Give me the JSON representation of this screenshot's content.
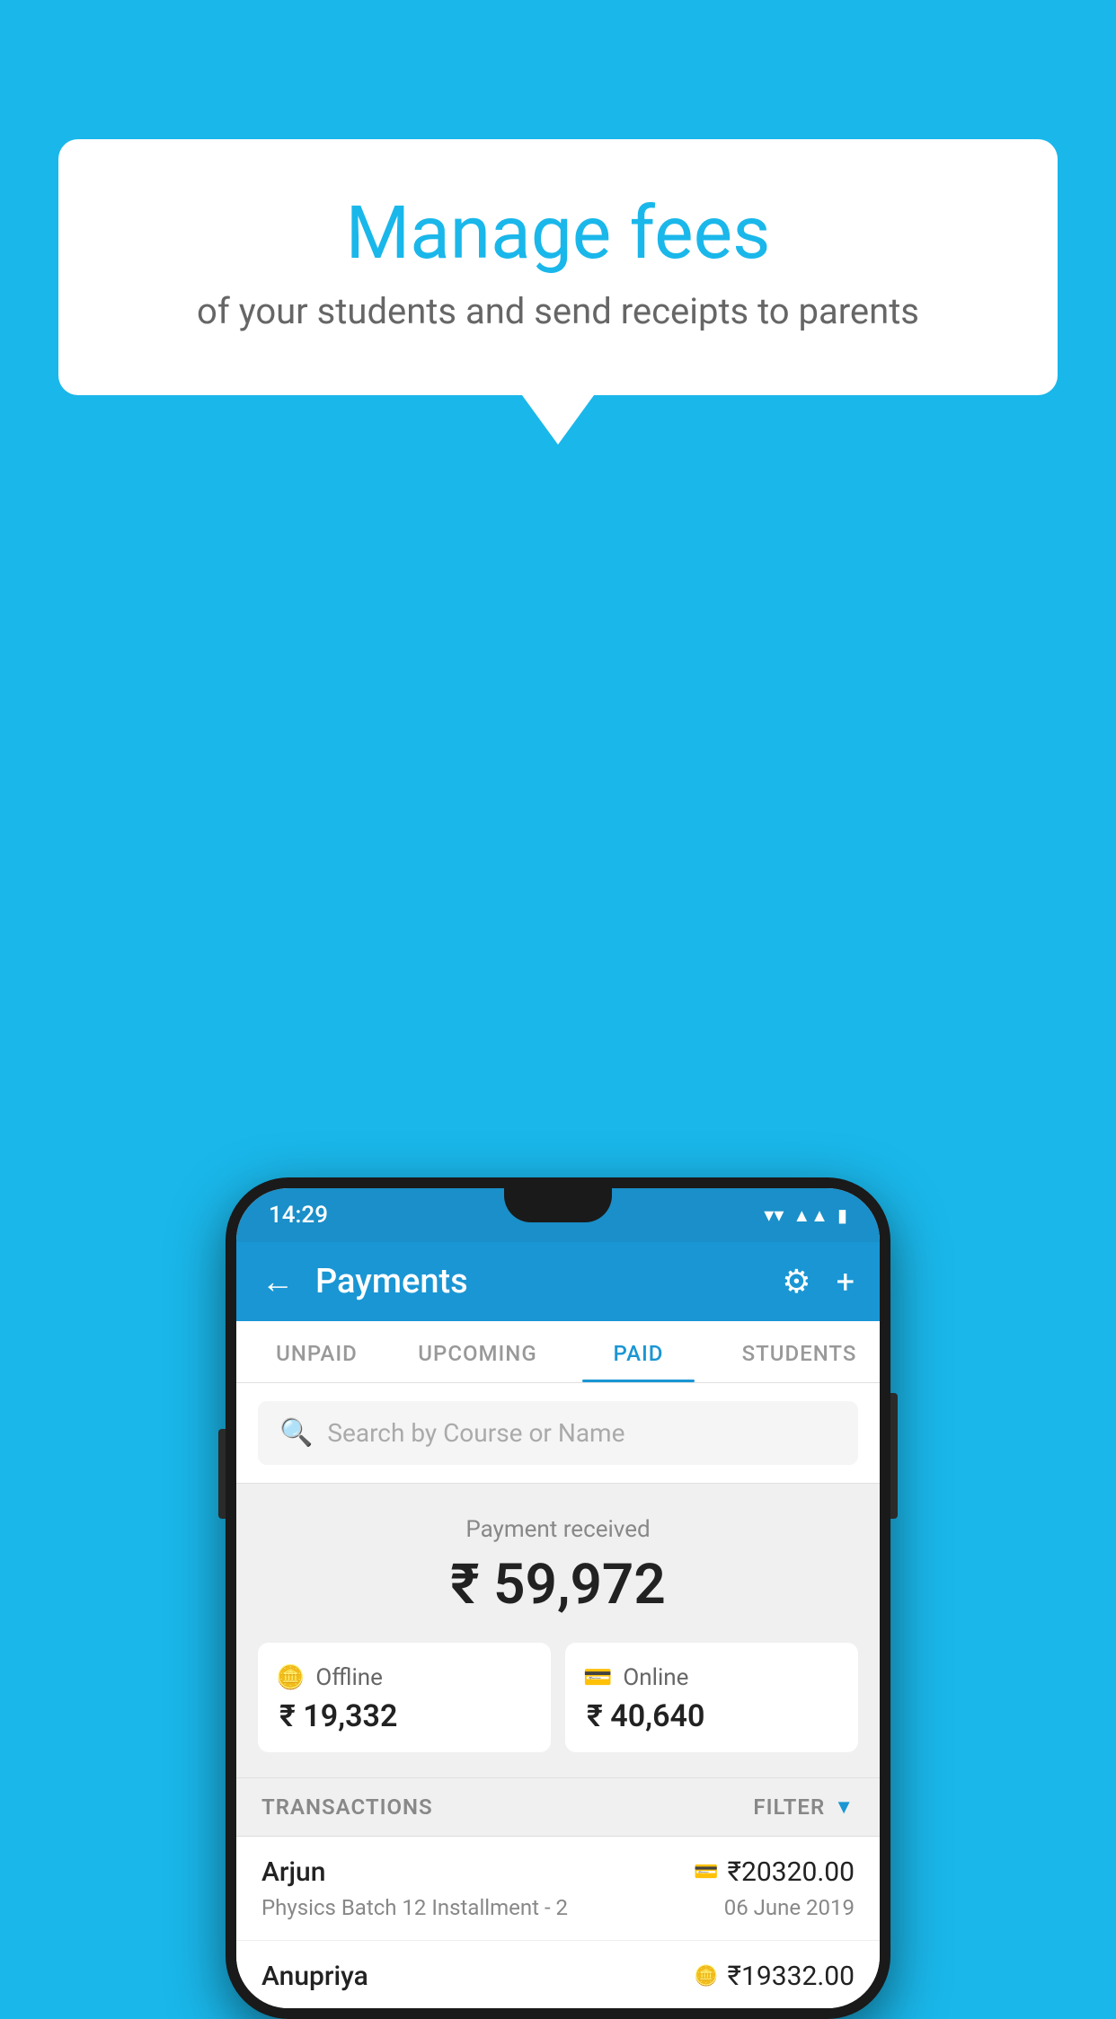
{
  "background_color": "#1ab7ea",
  "speech_bubble": {
    "title": "Manage fees",
    "subtitle": "of your students and send receipts to parents"
  },
  "status_bar": {
    "time": "14:29",
    "icons": [
      "wifi",
      "signal",
      "battery"
    ]
  },
  "app_bar": {
    "title": "Payments",
    "back_label": "←",
    "gear_label": "⚙",
    "plus_label": "+"
  },
  "tabs": [
    {
      "label": "UNPAID",
      "active": false
    },
    {
      "label": "UPCOMING",
      "active": false
    },
    {
      "label": "PAID",
      "active": true
    },
    {
      "label": "STUDENTS",
      "active": false
    }
  ],
  "search": {
    "placeholder": "Search by Course or Name"
  },
  "payment_summary": {
    "received_label": "Payment received",
    "total_amount": "₹ 59,972",
    "offline_label": "Offline",
    "offline_amount": "₹ 19,332",
    "online_label": "Online",
    "online_amount": "₹ 40,640"
  },
  "transactions": {
    "header_label": "TRANSACTIONS",
    "filter_label": "FILTER",
    "rows": [
      {
        "name": "Arjun",
        "description": "Physics Batch 12 Installment - 2",
        "amount": "₹20320.00",
        "date": "06 June 2019",
        "payment_type": "card"
      },
      {
        "name": "Anupriya",
        "description": "",
        "amount": "₹19332.00",
        "date": "",
        "payment_type": "cash"
      }
    ]
  }
}
